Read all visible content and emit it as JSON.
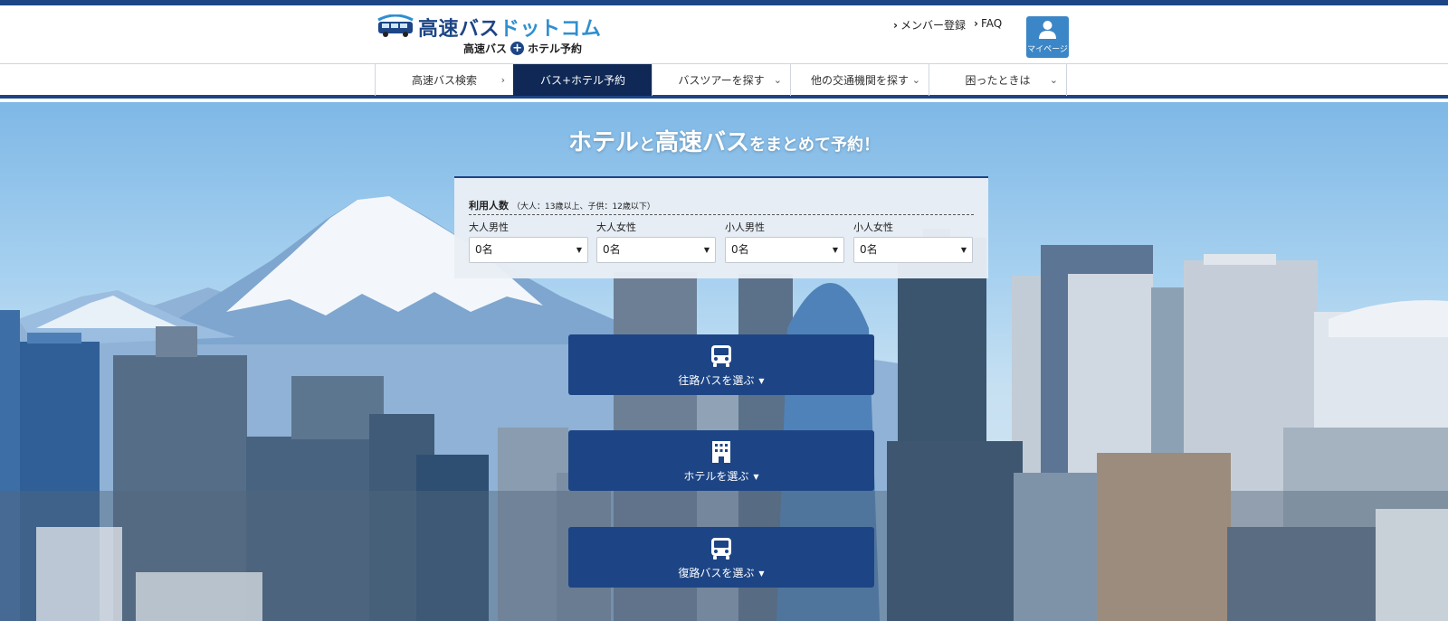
{
  "header": {
    "logo_title_main": "高速バス",
    "logo_title_accent": "ドットコム",
    "logo_sub_left": "高速バス",
    "logo_sub_plus": "+",
    "logo_sub_right": "ホテル予約",
    "links": [
      {
        "label": "メンバー登録",
        "chevron": "›"
      },
      {
        "label": "FAQ",
        "chevron": "›"
      }
    ],
    "mypage_label": "マイページ"
  },
  "nav": {
    "items": [
      {
        "label": "高速バス検索",
        "arrow": "›",
        "active": false
      },
      {
        "label": "バス+ホテル予約",
        "arrow": "",
        "active": true
      },
      {
        "label": "バスツアーを探す",
        "arrow": "⌄",
        "active": false
      },
      {
        "label": "他の交通機関を探す",
        "arrow": "⌄",
        "active": false
      },
      {
        "label": "困ったときは",
        "arrow": "⌄",
        "active": false
      }
    ]
  },
  "hero": {
    "title_part1": "ホテル",
    "title_part2": "と",
    "title_part3": "高速バス",
    "title_part4": "をまとめて予約！"
  },
  "passengers": {
    "heading": "利用人数",
    "note": "（大人：13歳以上、子供：12歳以下）",
    "fields": [
      {
        "label": "大人男性",
        "value": "0名"
      },
      {
        "label": "大人女性",
        "value": "0名"
      },
      {
        "label": "小人男性",
        "value": "0名"
      },
      {
        "label": "小人女性",
        "value": "0名"
      }
    ],
    "caret": "▼"
  },
  "actions": {
    "outbound_label": "往路バスを選ぶ",
    "hotel_label": "ホテルを選ぶ",
    "return_label": "復路バスを選ぶ",
    "chevron": "▼"
  },
  "icons": {
    "bus": "bus-icon",
    "hotel": "building-icon",
    "user": "user-icon"
  },
  "colors": {
    "brand_navy": "#1d4585",
    "nav_active": "#0f2855",
    "accent_blue": "#3b86c6"
  }
}
